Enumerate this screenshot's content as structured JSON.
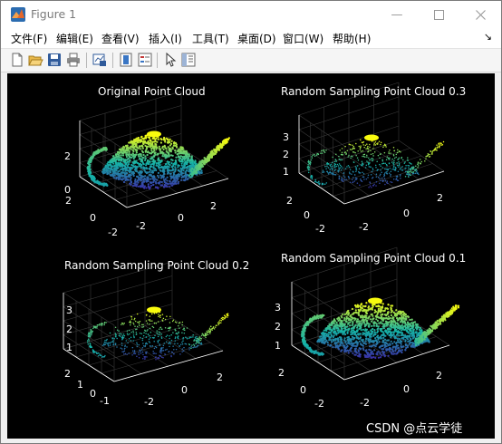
{
  "window": {
    "title": "Figure 1"
  },
  "menu": [
    "文件(F)",
    "编辑(E)",
    "查看(V)",
    "插入(I)",
    "工具(T)",
    "桌面(D)",
    "窗口(W)",
    "帮助(H)"
  ],
  "toolbar": [
    "new-figure-icon",
    "open-file-icon",
    "save-icon",
    "print-icon",
    "link-plot-icon",
    "insert-colorbar-icon",
    "insert-legend-icon",
    "select-arrow-icon",
    "property-inspector-icon"
  ],
  "plots": [
    {
      "title": "Original Point Cloud",
      "z_ticks": [
        "2",
        "0"
      ],
      "y_ticks": [
        "2",
        "0",
        "-2"
      ],
      "x_ticks": [
        "-2",
        "0",
        "2"
      ],
      "density": "dense",
      "colormap": "parula"
    },
    {
      "title": "Random Sampling Point Cloud 0.3",
      "z_ticks": [
        "3",
        "2",
        "1"
      ],
      "y_ticks": [
        "2",
        "0",
        "-2"
      ],
      "x_ticks": [
        "-2",
        "0",
        "2"
      ],
      "density": "sparse",
      "colormap": "parula"
    },
    {
      "title": "Random Sampling Point Cloud 0.2",
      "z_ticks": [
        "3",
        "2",
        "1"
      ],
      "y_ticks": [
        "2",
        "1",
        "0",
        "-1"
      ],
      "x_ticks": [
        "-2",
        "0",
        "2"
      ],
      "density": "sparse",
      "colormap": "parula"
    },
    {
      "title": "Random Sampling Point Cloud 0.1",
      "z_ticks": [
        "3",
        "2",
        "1"
      ],
      "y_ticks": [
        "2",
        "0",
        "-2"
      ],
      "x_ticks": [
        "-2",
        "0",
        "2"
      ],
      "density": "dense",
      "colormap": "parula"
    }
  ],
  "watermark": "CSDN @点云学徒",
  "colors": {
    "canvas": "#000000",
    "ticks": "#ffffff",
    "parula_low": "#3e26a8",
    "parula_mid": "#15b2a7",
    "parula_high": "#f9fb0e"
  }
}
